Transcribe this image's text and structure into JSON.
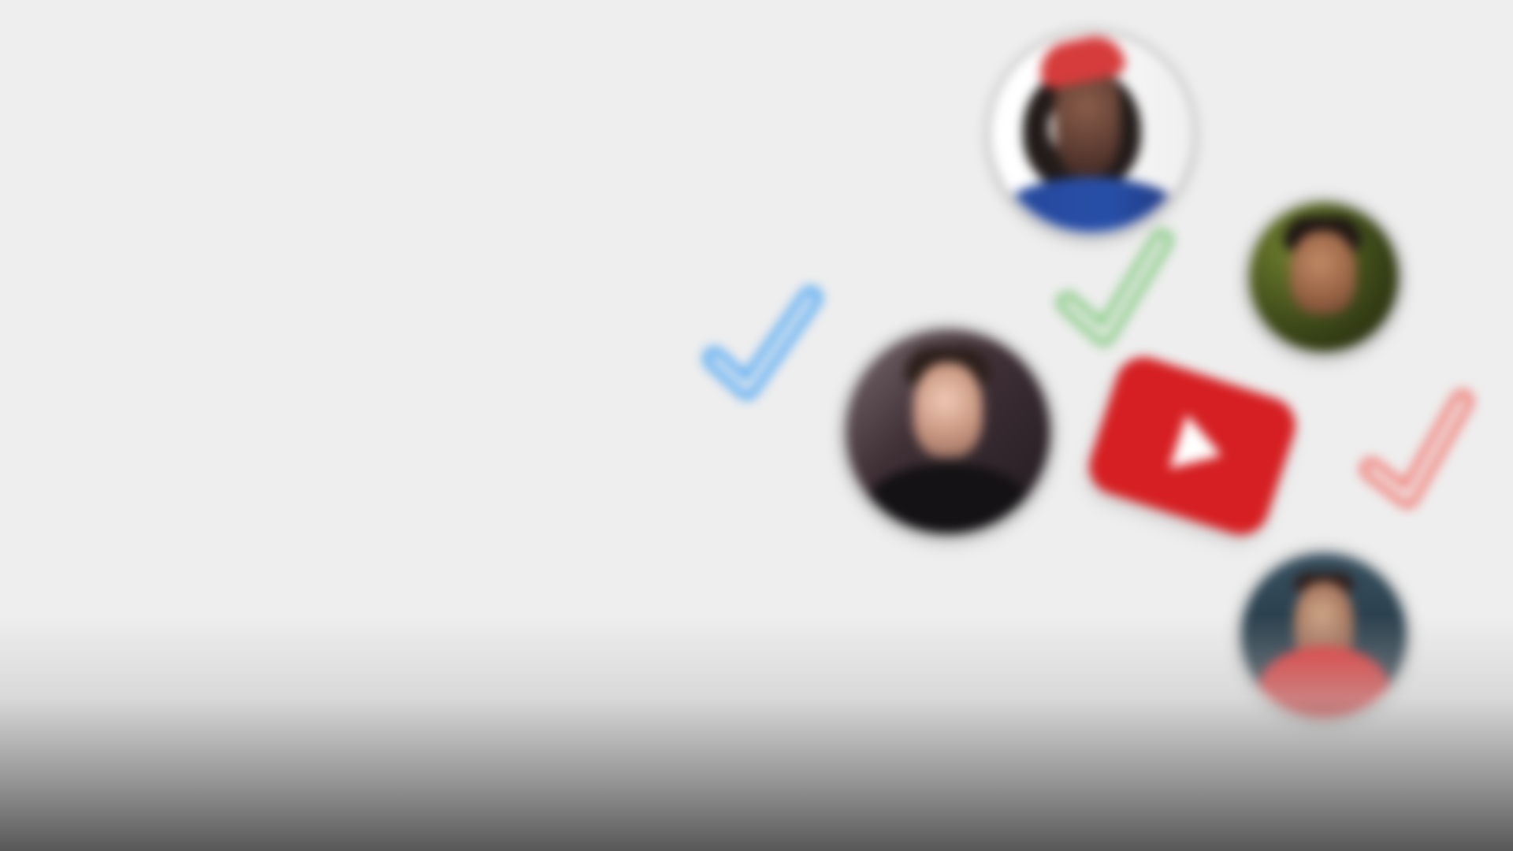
{
  "scene": {
    "background": "#eeeeee",
    "accent_colors": {
      "blue": "#56aaf3",
      "green": "#8ccc89",
      "red": "#f08079",
      "youtube_red": "#d51f22"
    }
  },
  "graphics": {
    "profile_avatars": [
      {
        "icon": "profile-avatar-icon"
      },
      {
        "icon": "profile-avatar-icon"
      },
      {
        "icon": "profile-avatar-icon"
      },
      {
        "icon": "profile-avatar-icon"
      }
    ],
    "check_marks": [
      {
        "icon": "checkmark-icon",
        "color": "#56aaf3"
      },
      {
        "icon": "checkmark-icon",
        "color": "#8ccc89"
      },
      {
        "icon": "checkmark-icon",
        "color": "#f08079"
      }
    ],
    "youtube_logo": {
      "icon": "youtube-play-icon",
      "color": "#d51f22"
    }
  }
}
